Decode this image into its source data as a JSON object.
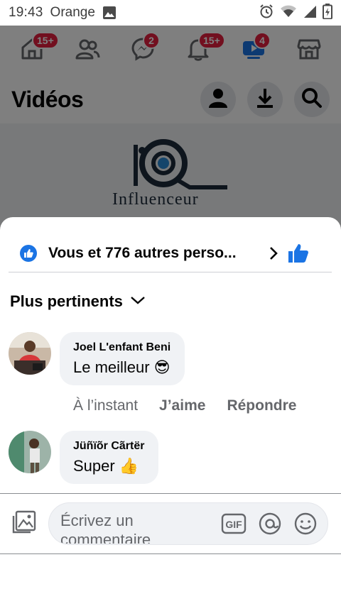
{
  "status_bar": {
    "time": "19:43",
    "carrier": "Orange"
  },
  "nav": {
    "home_badge": "15+",
    "friends_badge": "",
    "messenger_badge": "2",
    "notifications_badge": "15+",
    "videos_badge": "4"
  },
  "videos": {
    "title": "Vidéos",
    "brand_text": "Influenceur"
  },
  "sheet": {
    "reactions_text": "Vous et 776 autres perso...",
    "sort_label": "Plus pertinents",
    "comments": [
      {
        "author": "Joel L'enfant Beni",
        "text": "Le meilleur",
        "emoji": "😎",
        "time": "À l’instant",
        "like": "J’aime",
        "reply": "Répondre"
      },
      {
        "author": "Jüñïõr Cãrtër",
        "text": "Super",
        "emoji": "👍"
      }
    ],
    "composer": {
      "placeholder": "Écrivez un commentaire",
      "gif": "GIF"
    }
  },
  "colors": {
    "accent": "#1b74e4",
    "badge": "#e41e3f",
    "bubble": "#f0f2f5",
    "secondary_text": "#65676b"
  }
}
